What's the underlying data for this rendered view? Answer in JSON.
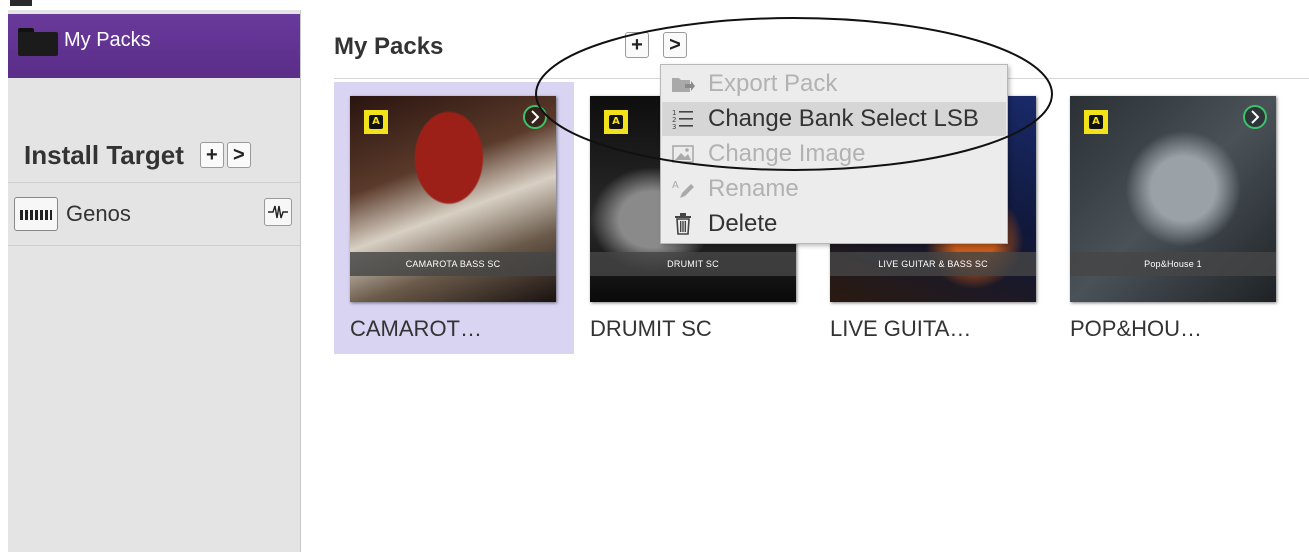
{
  "sidebar": {
    "my_packs_label": "My Packs",
    "install_target": {
      "title": "Install Target",
      "add_label": "+",
      "next_label": ">"
    },
    "targets": [
      {
        "name": "Genos"
      }
    ]
  },
  "main": {
    "title": "My Packs",
    "add_label": "+",
    "next_label": ">"
  },
  "packs": [
    {
      "label": "CAMAROT…",
      "caption": "CAMAROTA BASS SC",
      "selected": true
    },
    {
      "label": "DRUMIT SC",
      "caption": "DRUMIT SC",
      "selected": false
    },
    {
      "label": "LIVE GUITA…",
      "caption": "LIVE GUITAR & BASS SC",
      "selected": false
    },
    {
      "label": "POP&HOU…",
      "caption": "Pop&House 1",
      "selected": false
    }
  ],
  "context_menu": {
    "items": [
      {
        "label": "Export Pack",
        "icon": "export-pack-icon",
        "enabled": false
      },
      {
        "label": "Change Bank Select LSB",
        "icon": "numbered-list-icon",
        "enabled": true,
        "highlighted": true
      },
      {
        "label": "Change Image",
        "icon": "image-icon",
        "enabled": false
      },
      {
        "label": "Rename",
        "icon": "rename-icon",
        "enabled": false
      },
      {
        "label": "Delete",
        "icon": "trash-icon",
        "enabled": true
      }
    ]
  },
  "colors": {
    "sidebar_active": "#5a2d88",
    "selected_pack": "#d8d4f2",
    "badge_yellow": "#f2e21a",
    "go_green": "#3cc36a"
  }
}
